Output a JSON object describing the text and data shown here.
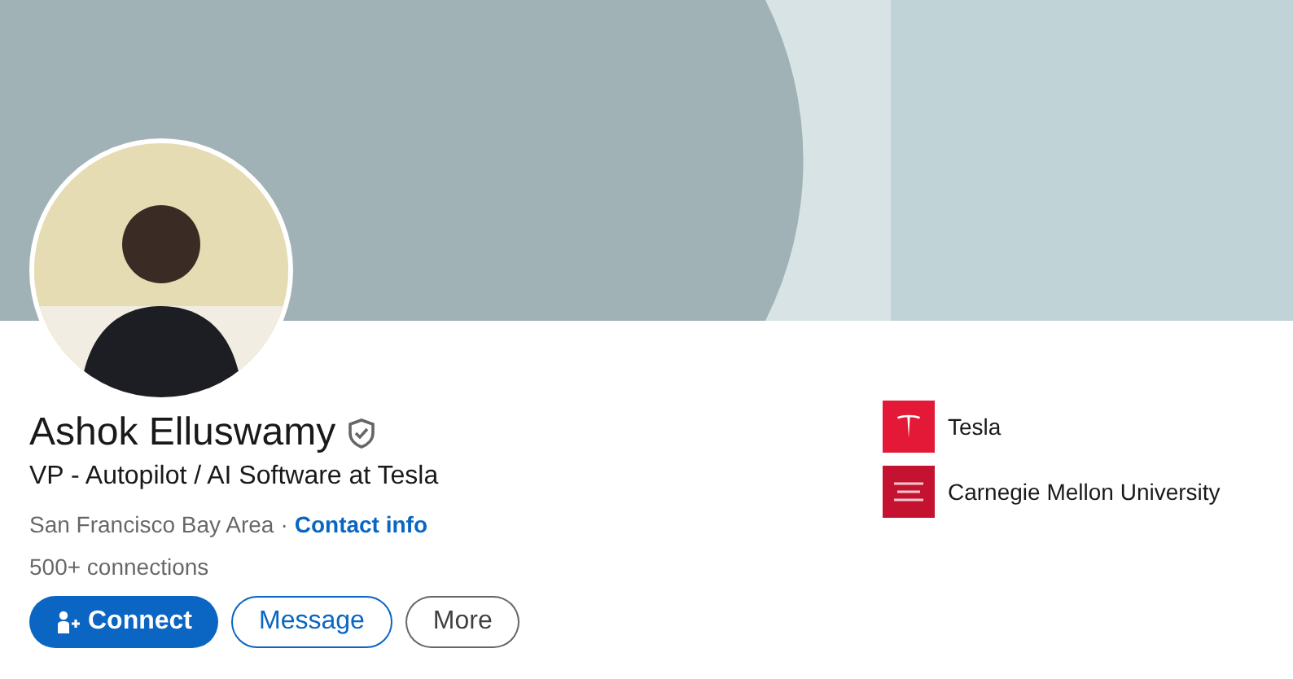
{
  "profile": {
    "name": "Ashok Elluswamy",
    "verified": true,
    "headline": "VP - Autopilot / AI Software at Tesla",
    "location": "San Francisco Bay Area",
    "separator": "·",
    "contact_link": "Contact info",
    "connections": "500+ connections"
  },
  "actions": [
    {
      "label": "Connect",
      "kind": "primary"
    },
    {
      "label": "Message",
      "kind": "outline"
    },
    {
      "label": "More",
      "kind": "neutral"
    }
  ],
  "affiliations": [
    {
      "name": "Tesla",
      "kind": "company"
    },
    {
      "name": "Carnegie Mellon University",
      "kind": "school"
    }
  ]
}
